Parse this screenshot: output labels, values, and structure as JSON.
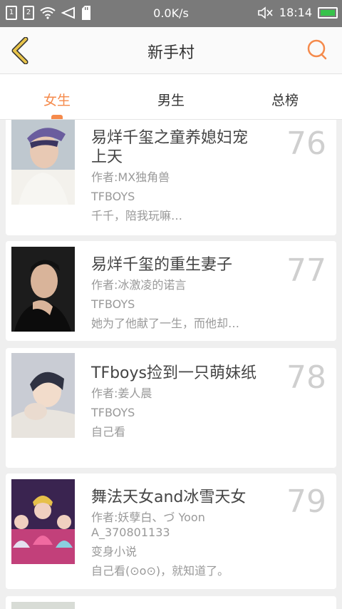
{
  "status": {
    "sim1": "1",
    "sim2": "2",
    "speed": "0.0K/s",
    "time": "18:14"
  },
  "header": {
    "title": "新手村"
  },
  "tabs": [
    {
      "label": "女生",
      "active": true
    },
    {
      "label": "男生",
      "active": false
    },
    {
      "label": "总榜",
      "active": false
    }
  ],
  "books": [
    {
      "rank": "76",
      "title": "易烊千玺之童养媳妇宠上天",
      "author": "作者:MX独角兽",
      "category": "TFBOYS",
      "desc": "千千，陪我玩嘛…"
    },
    {
      "rank": "77",
      "title": "易烊千玺的重生妻子",
      "author": "作者:冰激凌的诺言",
      "category": "TFBOYS",
      "desc": "她为了他献了一生，而他却…"
    },
    {
      "rank": "78",
      "title": "TFboys捡到一只萌妹纸",
      "author": "作者:姜人晨",
      "category": "TFBOYS",
      "desc": "自己看"
    },
    {
      "rank": "79",
      "title": "舞法天女and冰雪天女",
      "author": "作者:妖孽白、づ Yoon A_370801133",
      "category": "变身小说",
      "desc": "自己看(⊙o⊙)，就知道了。"
    }
  ],
  "colors": {
    "accent": "#f58a4b",
    "back_arrow": "#e8c44a"
  }
}
